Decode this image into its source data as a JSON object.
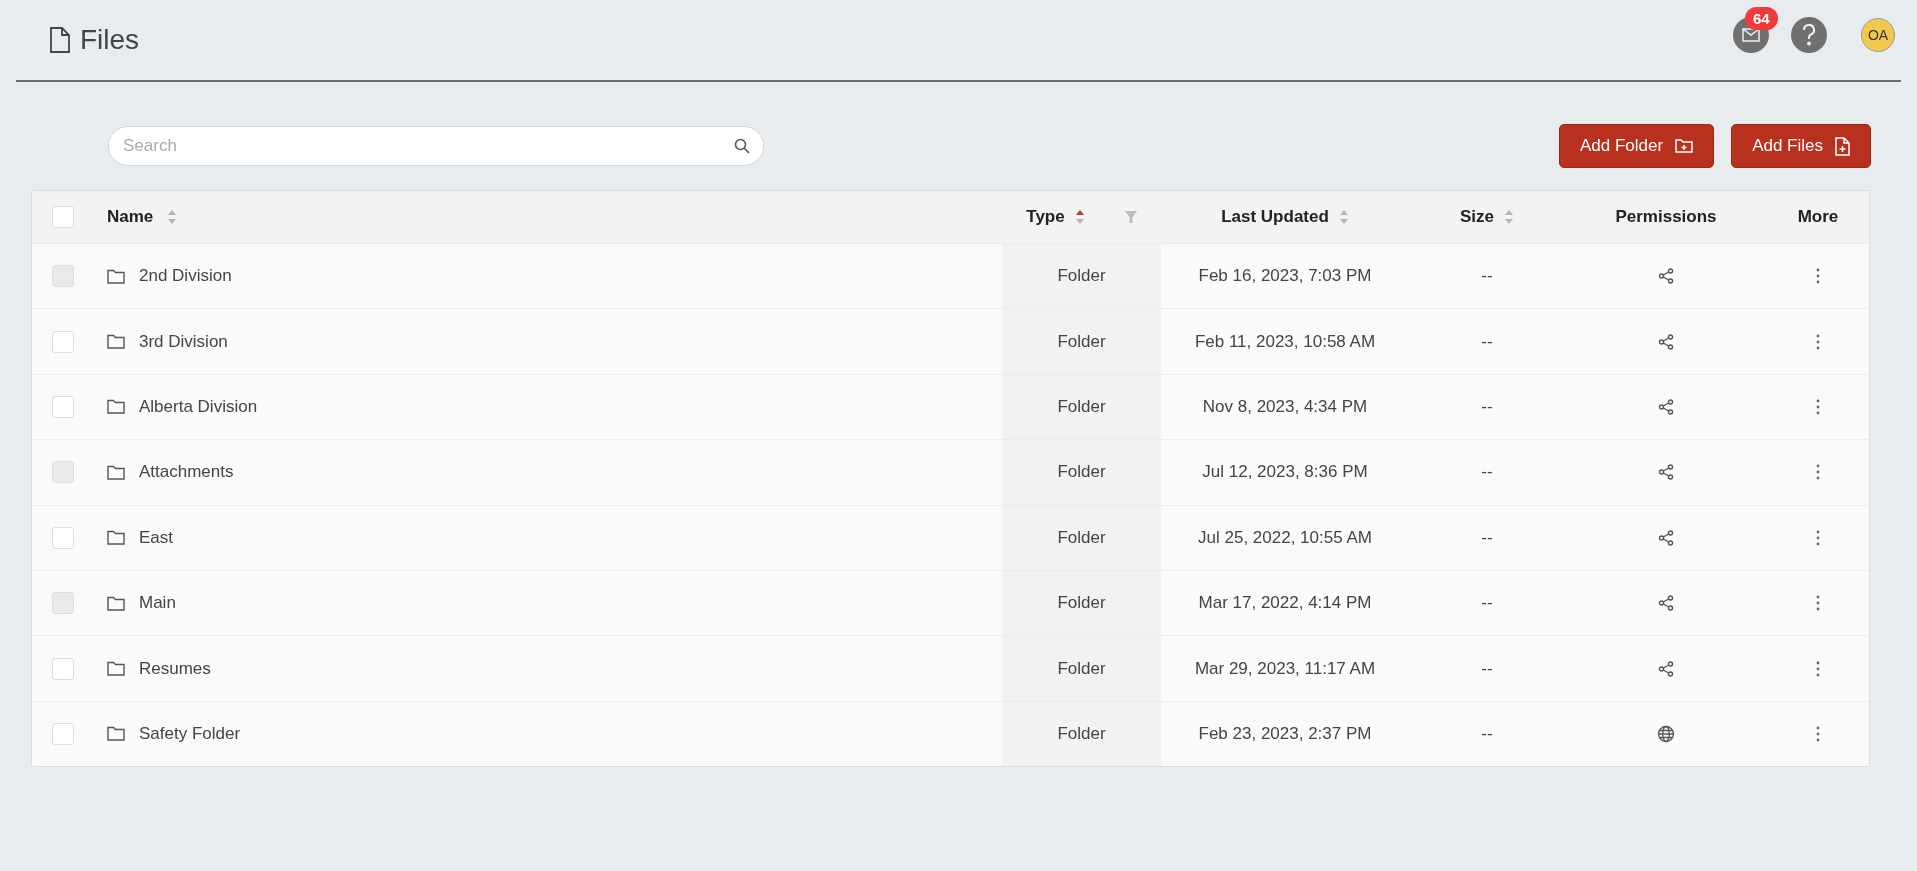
{
  "header": {
    "title": "Files",
    "notification_count": "64",
    "avatar_initials": "OA"
  },
  "search": {
    "placeholder": "Search"
  },
  "buttons": [
    {
      "label": "Add Folder",
      "kind": "folder"
    },
    {
      "label": "Add Files",
      "kind": "file"
    }
  ],
  "table": {
    "select_all": {
      "checked": false
    },
    "columns": [
      {
        "label": "Name",
        "sortable": true,
        "sorted": false,
        "filter": false
      },
      {
        "label": "Type",
        "sortable": true,
        "sorted": true,
        "filter": true
      },
      {
        "label": "Last Updated",
        "sortable": true,
        "sorted": false,
        "filter": false
      },
      {
        "label": "Size",
        "sortable": true,
        "sorted": false,
        "filter": false
      },
      {
        "label": "Permissions",
        "sortable": false,
        "filter": false
      },
      {
        "label": "More",
        "sortable": false,
        "filter": false
      }
    ],
    "rows": [
      {
        "name": "2nd Division",
        "type": "Folder",
        "updated": "Feb 16, 2023, 7:03 PM",
        "size": "--",
        "kind": "shared",
        "checked": false,
        "disabled": true
      },
      {
        "name": "3rd Division",
        "type": "Folder",
        "updated": "Feb 11, 2023, 10:58 AM",
        "size": "--",
        "kind": "shared",
        "checked": false,
        "disabled": false
      },
      {
        "name": "Alberta Division",
        "type": "Folder",
        "updated": "Nov 8, 2023, 4:34 PM",
        "size": "--",
        "kind": "shared",
        "checked": false,
        "disabled": false
      },
      {
        "name": "Attachments",
        "type": "Folder",
        "updated": "Jul 12, 2023, 8:36 PM",
        "size": "--",
        "kind": "shared",
        "checked": false,
        "disabled": true
      },
      {
        "name": "East",
        "type": "Folder",
        "updated": "Jul 25, 2022, 10:55 AM",
        "size": "--",
        "kind": "shared",
        "checked": false,
        "disabled": false
      },
      {
        "name": "Main",
        "type": "Folder",
        "updated": "Mar 17, 2022, 4:14 PM",
        "size": "--",
        "kind": "shared",
        "checked": false,
        "disabled": true
      },
      {
        "name": "Resumes",
        "type": "Folder",
        "updated": "Mar 29, 2023, 11:17 AM",
        "size": "--",
        "kind": "shared",
        "checked": false,
        "disabled": false
      },
      {
        "name": "Safety Folder",
        "type": "Folder",
        "updated": "Feb 23, 2023, 2:37 PM",
        "size": "--",
        "kind": "public",
        "checked": false,
        "disabled": false
      }
    ]
  }
}
